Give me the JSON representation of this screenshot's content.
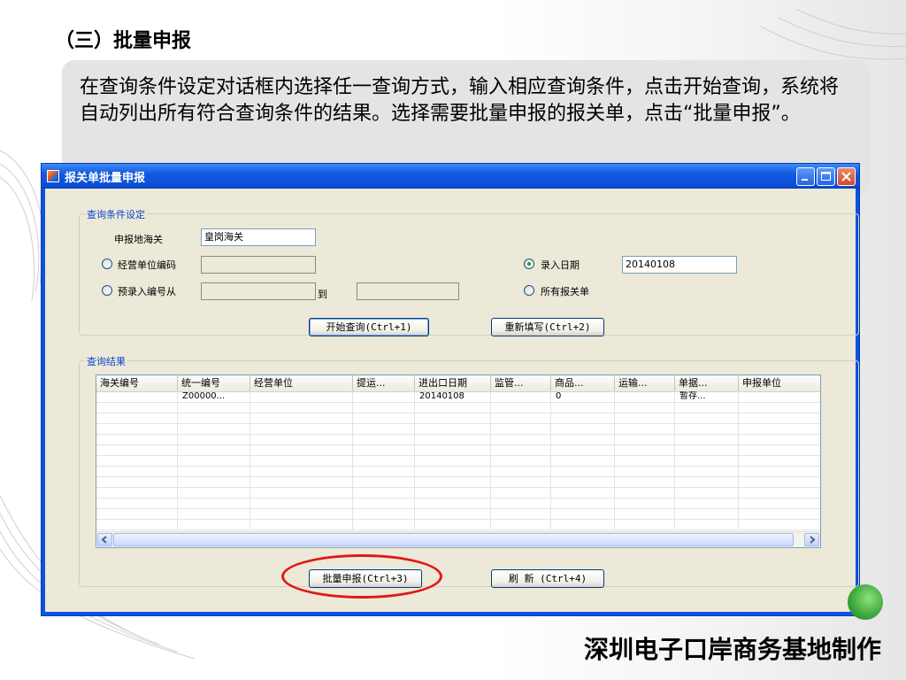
{
  "slide": {
    "heading": "（三）批量申报",
    "description": "在查询条件设定对话框内选择任一查询方式，输入相应查询条件，点击开始查询，系统将自动列出所有符合查询条件的结果。选择需要批量申报的报关单，点击“批量申报”。",
    "footer": "深圳电子口岸商务基地制作"
  },
  "window": {
    "title": "报关单批量申报",
    "icon": "app-icon",
    "controls": [
      "minimize-icon",
      "maximize-icon",
      "close-icon"
    ]
  },
  "query": {
    "legend": "查询条件设定",
    "customs_label": "申报地海关",
    "customs_value": "皇岗海关",
    "enterprise_label": "经营单位编码",
    "enterprise_value": "",
    "prerecord_label": "预录入编号从",
    "prerecord_from": "",
    "to_label": "到",
    "prerecord_to": "",
    "entry_date_label": "录入日期",
    "entry_date_value": "20140108",
    "all_label": "所有报关单",
    "selected_option": "录入日期",
    "start_button": "开始查询(Ctrl+1)",
    "reset_button": "重新填写(Ctrl+2)"
  },
  "results": {
    "legend": "查询结果",
    "columns": [
      "海关编号",
      "统一编号",
      "经营单位",
      "提运...",
      "进出口日期",
      "监管...",
      "商品...",
      "运输...",
      "单据...",
      "申报单位"
    ],
    "rows": [
      [
        "",
        "Z00000...",
        "",
        "",
        "20140108",
        "",
        "0",
        "",
        "暂存...",
        ""
      ]
    ]
  },
  "actions": {
    "batch_button": "批量申报(Ctrl+3)",
    "refresh_button": "刷  新 (Ctrl+4)"
  },
  "colors": {
    "titlebar": "#0a54df",
    "highlight_oval": "#e01818",
    "dialog_bg": "#ece9d8"
  }
}
